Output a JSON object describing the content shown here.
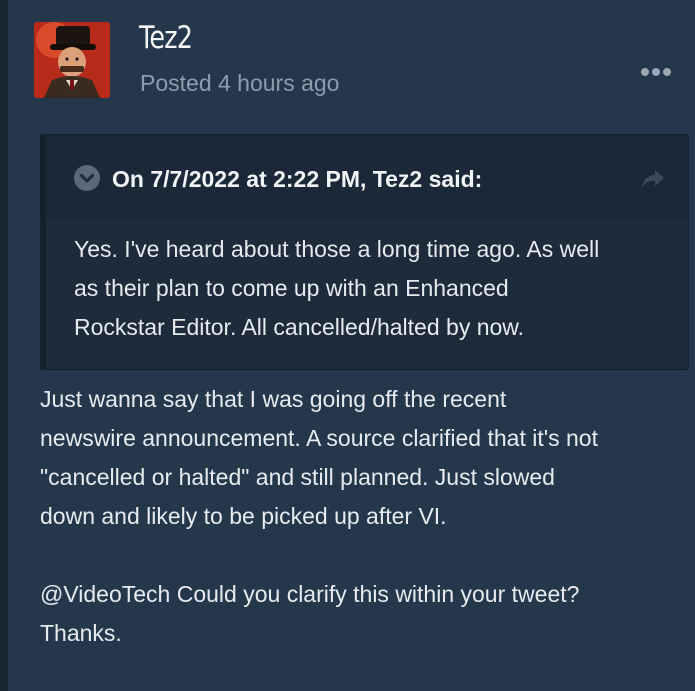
{
  "post": {
    "author": "Tez2",
    "timestamp": "Posted 4 hours ago",
    "menu_icon": "ellipsis-icon",
    "quote": {
      "citation": "On 7/7/2022 at 2:22 PM, Tez2 said:",
      "toggle_icon": "chevron-down-icon",
      "share_icon": "share-arrow-icon",
      "lines": [
        "Yes. I've heard about those a long time ago. As well",
        "as their plan to come up with an Enhanced",
        "Rockstar Editor. All cancelled/halted by now."
      ]
    },
    "body_lines": [
      "Just wanna say that I was going off the recent",
      "newswire announcement. A source clarified that it's not",
      "\"cancelled or halted\" and still planned. Just slowed",
      "down and likely to be picked up after VI."
    ],
    "body_lines_2": [
      "@VideoTech Could you clarify this within your tweet?",
      "Thanks."
    ]
  },
  "colors": {
    "background": "#25384b",
    "quote_background": "#1d2b3a",
    "quote_header": "#1a2837",
    "text": "#e6ebf0",
    "muted_text": "#8e9cab"
  }
}
